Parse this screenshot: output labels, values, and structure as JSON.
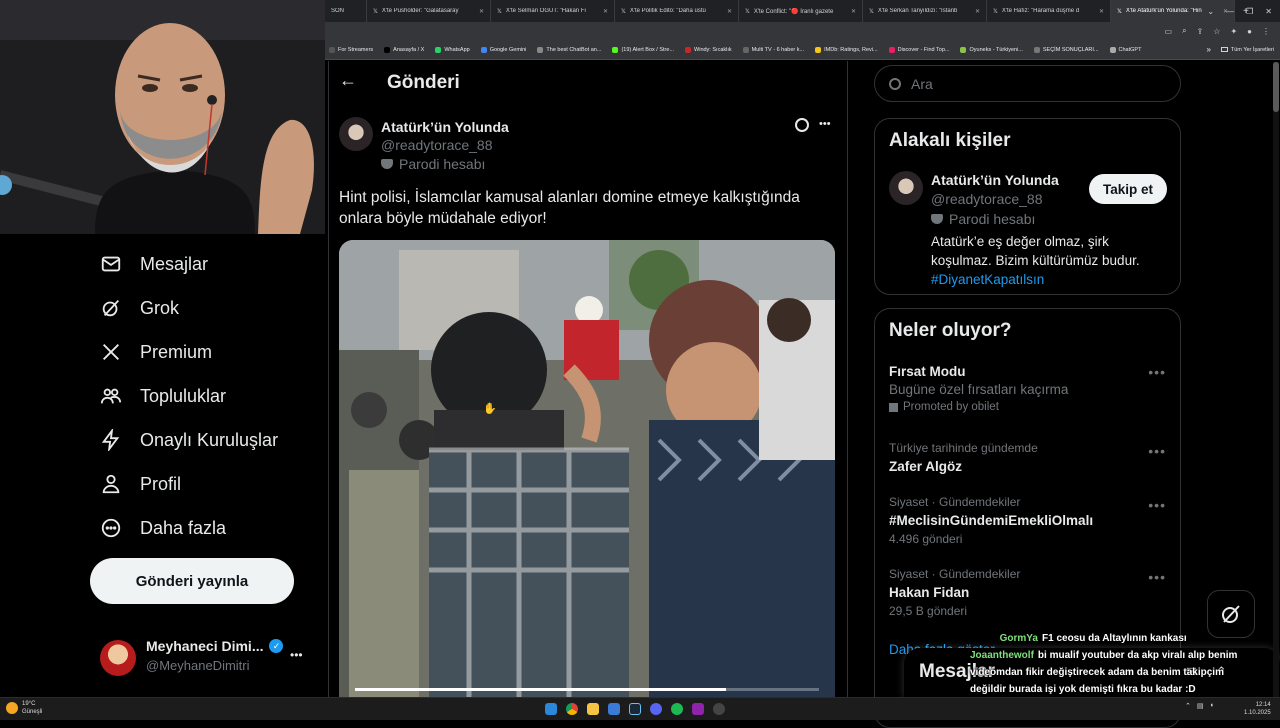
{
  "browser": {
    "tabs": [
      {
        "label": "SON",
        "active": false
      },
      {
        "label": "X'te Pusholder: \"Galatasaray",
        "active": false
      },
      {
        "label": "X'te Selman ÖĞÜT: \"Hakan Fi",
        "active": false
      },
      {
        "label": "X'te Politik Editö: \"Daha üstü",
        "active": false
      },
      {
        "label": "X'te Conflict: \"🔴 İranlı gazete",
        "active": false
      },
      {
        "label": "X'te Serkan Tanyıldızı: \"İstanb",
        "active": false
      },
      {
        "label": "X'te Hafız: \"Harama düşme d",
        "active": false
      },
      {
        "label": "X'te Atatürk'ün Yolunda: \"Hin",
        "active": true
      }
    ],
    "new_tab": "+",
    "bookmarks": [
      {
        "label": "For Streamers",
        "color": "#555"
      },
      {
        "label": "Anasayfa / X",
        "color": "#000"
      },
      {
        "label": "WhatsApp",
        "color": "#25d366"
      },
      {
        "label": "Google Gemini",
        "color": "#4285f4"
      },
      {
        "label": "The best ChatBot an...",
        "color": "#888"
      },
      {
        "label": "(19) Alert Box / Stre...",
        "color": "#53fc18"
      },
      {
        "label": "Windy: Sıcaklık",
        "color": "#c62828"
      },
      {
        "label": "Multi TV - 6 haber k...",
        "color": "#666"
      },
      {
        "label": "IMDb: Ratings, Revi...",
        "color": "#f5c518"
      },
      {
        "label": "Discover - Find Top...",
        "color": "#e91e63"
      },
      {
        "label": "Oyuneks - Türkiyeni...",
        "color": "#8bc34a"
      },
      {
        "label": "SEÇİM SONUÇLARI...",
        "color": "#777"
      },
      {
        "label": "ChatGPT",
        "color": "#aaa"
      }
    ],
    "bookmarks_more": "»",
    "all_bookmarks": "Tüm Yer İşaretleri"
  },
  "nav": {
    "items": [
      {
        "label": "Mesajlar",
        "icon": "envelope-icon"
      },
      {
        "label": "Grok",
        "icon": "grok-icon"
      },
      {
        "label": "Premium",
        "icon": "x-logo-icon"
      },
      {
        "label": "Topluluklar",
        "icon": "communities-icon"
      },
      {
        "label": "Onaylı Kuruluşlar",
        "icon": "lightning-icon"
      },
      {
        "label": "Profil",
        "icon": "person-icon"
      },
      {
        "label": "Daha fazla",
        "icon": "more-circle-icon"
      }
    ],
    "post_button": "Gönderi yayınla",
    "account": {
      "name": "Meyhaneci Dimi...",
      "handle": "@MeyhaneDimitri",
      "more": "•••"
    }
  },
  "main": {
    "header_title": "Gönderi",
    "post": {
      "author_name": "Atatürk’ün Yolunda",
      "author_handle": "@readytorace_88",
      "parody_label": "Parodi hesabı",
      "text_line1": "Hint polisi, İslamcılar kamusal alanları domine etmeye kalkıştığında",
      "text_line2": "onlara böyle müdahale ediyor!",
      "more": "•••",
      "video_progress": 0.8
    }
  },
  "right": {
    "search_placeholder": "Ara",
    "related": {
      "title": "Alakalı kişiler",
      "name": "Atatürk’ün Yolunda",
      "handle": "@readytorace_88",
      "parody_label": "Parodi hesabı",
      "follow_button": "Takip et",
      "bio_line1": "Atatürk’e eş değer olmaz, şirk",
      "bio_line2": "koşulmaz. Bizim kültürümüz budur.",
      "bio_hashtag": "#DiyanetKapatılsın"
    },
    "trends": {
      "title": "Neler oluyor?",
      "items": [
        {
          "context": "",
          "title": "Fırsat Modu",
          "sub": "Bugüne özel fırsatları kaçırma",
          "meta": "Promoted by obilet"
        },
        {
          "context": "Türkiye tarihinde gündemde",
          "title": "Zafer Algöz",
          "sub": "",
          "meta": ""
        },
        {
          "context": "Siyaset · Gündemdekiler",
          "title": "#MeclisinGündemiEmekliOlmalı",
          "sub": "",
          "meta": "4.496 gönderi"
        },
        {
          "context": "Siyaset · Gündemdekiler",
          "title": "Hakan Fidan",
          "sub": "",
          "meta": "29,5 B gönderi"
        }
      ],
      "show_more": "Daha fazla göster",
      "more": "•••"
    },
    "messages_drawer": "Mesajlar"
  },
  "chat": [
    {
      "user": "GormYa",
      "user_color": "#7ee07a",
      "text": "F1 ceosu da Altaylının kankası"
    },
    {
      "user": "Joaanthewolf",
      "user_color": "#7ee07a",
      "text": "bi mualif youtuber da akp viralı alıp benim videomdan fikir değiştirecek adam da benim takipçim değildir burada işi yok demişti fıkra bu kadar :D"
    }
  ],
  "taskbar": {
    "weather_temp": "19°C",
    "weather_desc": "Güneşli",
    "time": "12:14",
    "date": "1.10.2025"
  },
  "colors": {
    "accent": "#1d9bf0",
    "border": "#2f3336",
    "muted": "#71767b"
  }
}
